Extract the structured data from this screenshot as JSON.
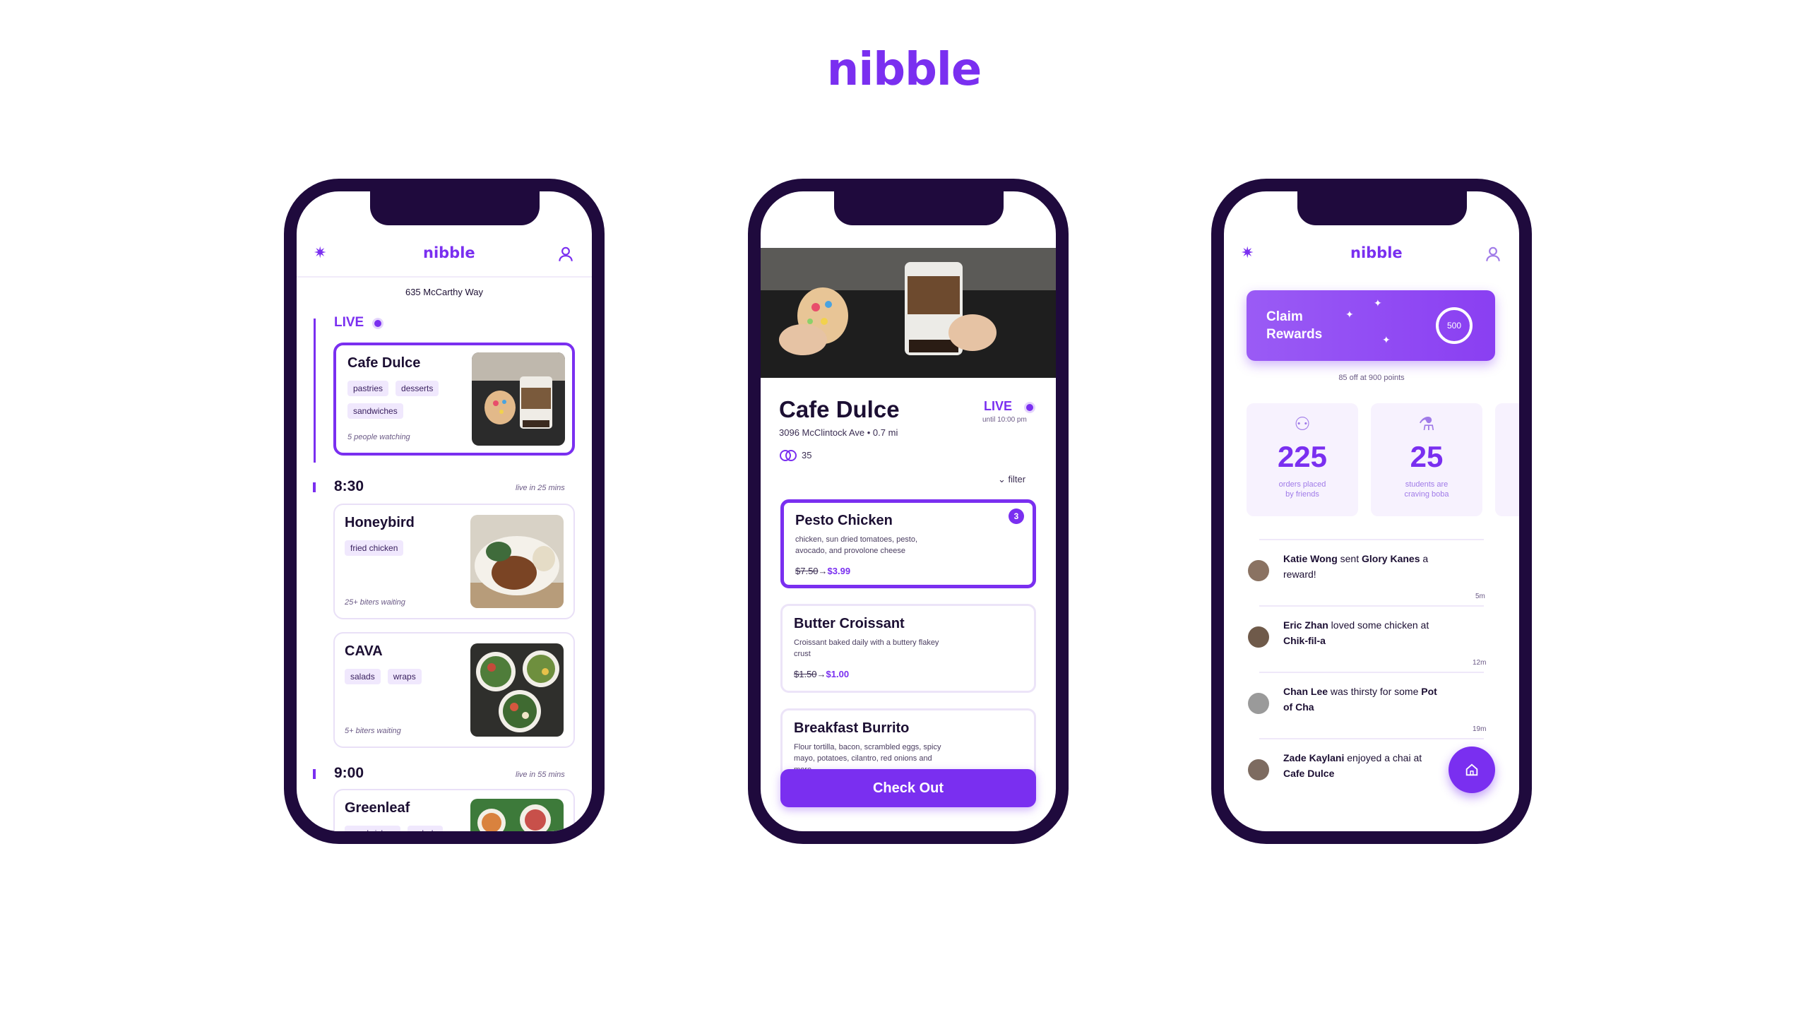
{
  "brand": "nibble",
  "phone1": {
    "logo": "nibble",
    "address": "635 McCarthy Way",
    "live_label": "LIVE",
    "live_card": {
      "name": "Cafe Dulce",
      "tags": [
        "pastries",
        "desserts",
        "sandwiches"
      ],
      "watching": "5 people watching"
    },
    "slot1": {
      "time": "8:30",
      "live_in": "live in 25 mins",
      "cards": [
        {
          "name": "Honeybird",
          "tags": [
            "fried chicken"
          ],
          "waiting": "25+ biters waiting"
        },
        {
          "name": "CAVA",
          "tags": [
            "salads",
            "wraps"
          ],
          "waiting": "5+ biters waiting"
        }
      ]
    },
    "slot2": {
      "time": "9:00",
      "live_in": "live in 55 mins",
      "cards": [
        {
          "name": "Greenleaf",
          "tags": [
            "sandwiches",
            "salads"
          ]
        }
      ]
    }
  },
  "phone2": {
    "title": "Cafe Dulce",
    "address": "3096 McClintock Ave • 0.7 mi",
    "live_label": "LIVE",
    "live_until": "until 10:00 pm",
    "watching_count": "35",
    "filter_label": "filter",
    "items": [
      {
        "name": "Pesto Chicken",
        "desc": "chicken, sun dried tomatoes, pesto, avocado, and provolone cheese",
        "old_price": "$7.50",
        "arrow": "→",
        "new_price": "$3.99",
        "qty": "3"
      },
      {
        "name": "Butter Croissant",
        "desc": "Croissant baked daily with a buttery flakey crust",
        "old_price": "$1.50",
        "arrow": "→",
        "new_price": "$1.00"
      },
      {
        "name": "Breakfast Burrito",
        "desc": "Flour tortilla, bacon, scrambled eggs, spicy mayo, potatoes, cilantro, red onions and more",
        "old_price": "",
        "arrow": "",
        "new_price": ""
      }
    ],
    "checkout_label": "Check Out"
  },
  "phone3": {
    "logo": "nibble",
    "claim_label_line1": "Claim",
    "claim_label_line2": "Rewards",
    "claim_points": "500",
    "points_note": "85 off at 900 points",
    "stats": [
      {
        "value": "225",
        "label_line1": "orders placed",
        "label_line2": "by friends"
      },
      {
        "value": "25",
        "label_line1": "students are",
        "label_line2": "craving boba"
      }
    ],
    "feed": [
      {
        "name": "Katie Wong",
        "verb": " sent ",
        "object": "Glory Kanes",
        "tail": " a reward!",
        "time": "5m"
      },
      {
        "name": "Eric Zhan",
        "verb": " loved some chicken at ",
        "object": "Chik-fil-a",
        "tail": "",
        "time": "12m"
      },
      {
        "name": "Chan Lee",
        "verb": " was thirsty for some ",
        "object": "Pot of Cha",
        "tail": "",
        "time": "19m"
      },
      {
        "name": "Zade Kaylani",
        "verb": " enjoyed a chai at ",
        "object": "Cafe Dulce",
        "tail": "",
        "time": ""
      }
    ]
  }
}
